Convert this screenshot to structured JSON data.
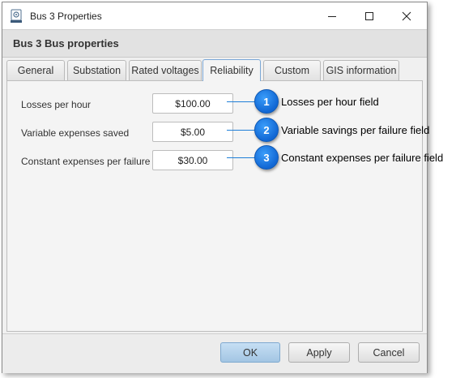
{
  "window": {
    "title": "Bus 3 Properties",
    "header": "Bus 3 Bus properties",
    "app_icon": "gear-doc-icon"
  },
  "tabs": [
    {
      "label": "General",
      "active": false
    },
    {
      "label": "Substation",
      "active": false
    },
    {
      "label": "Rated voltages",
      "active": false
    },
    {
      "label": "Reliability",
      "active": true
    },
    {
      "label": "Custom",
      "active": false
    },
    {
      "label": "GIS information",
      "active": false
    }
  ],
  "fields": [
    {
      "label": "Losses per hour",
      "value": "$100.00"
    },
    {
      "label": "Variable expenses saved",
      "value": "$5.00"
    },
    {
      "label": "Constant expenses per failure",
      "value": "$30.00"
    }
  ],
  "callouts": [
    {
      "number": "1",
      "text": "Losses per hour field"
    },
    {
      "number": "2",
      "text": "Variable savings per failure field"
    },
    {
      "number": "3",
      "text": "Constant expenses per failure field"
    }
  ],
  "buttons": {
    "ok": "OK",
    "apply": "Apply",
    "cancel": "Cancel"
  },
  "colors": {
    "callout": "#1a7ee6",
    "active_tab_border": "#7aa7d6",
    "default_button": "#b4d2ee"
  }
}
